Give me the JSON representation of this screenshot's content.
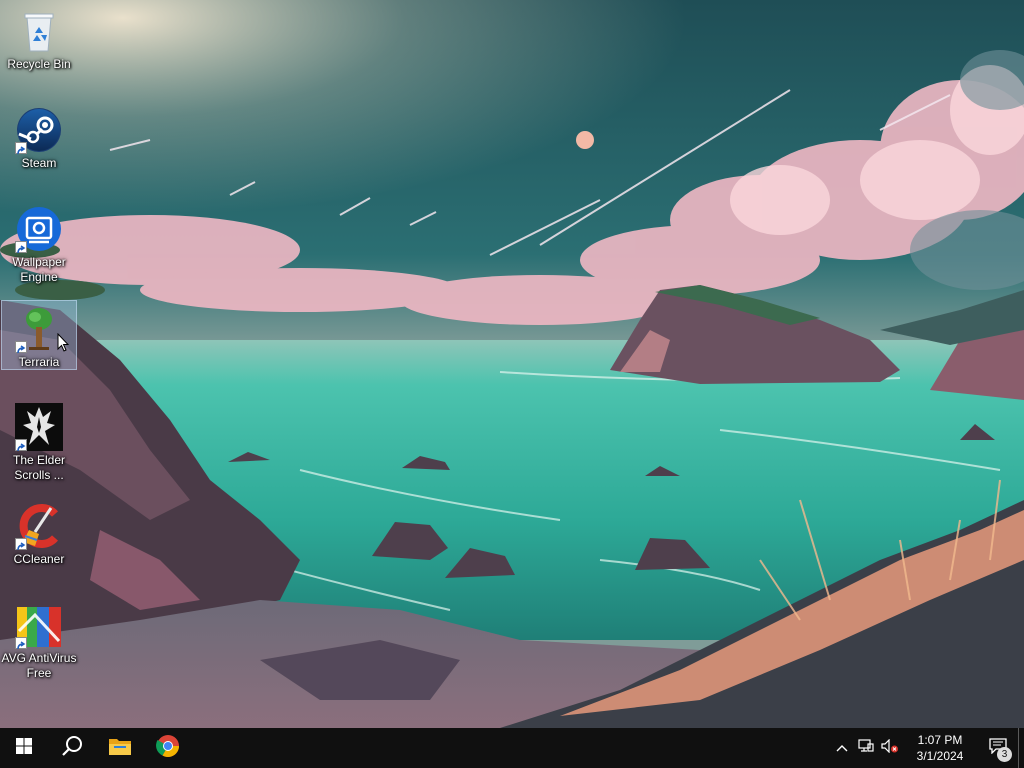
{
  "desktop": {
    "icons": [
      {
        "label": "Recycle Bin",
        "icon": "recycle-bin-icon",
        "shortcut": false,
        "selected": false
      },
      {
        "label": "Steam",
        "icon": "steam-icon",
        "shortcut": true,
        "selected": false
      },
      {
        "label": "Wallpaper Engine",
        "icon": "wallpaper-engine-icon",
        "shortcut": true,
        "selected": false
      },
      {
        "label": "Terraria",
        "icon": "terraria-tree-icon",
        "shortcut": true,
        "selected": true
      },
      {
        "label": "The Elder Scrolls ...",
        "icon": "skyrim-dragon-icon",
        "shortcut": true,
        "selected": false
      },
      {
        "label": "CCleaner",
        "icon": "ccleaner-icon",
        "shortcut": true,
        "selected": false
      },
      {
        "label": "AVG AntiVirus Free",
        "icon": "avg-antivirus-icon",
        "shortcut": true,
        "selected": false
      }
    ]
  },
  "taskbar": {
    "start_icon": "windows-logo-icon",
    "search_icon": "search-icon",
    "pinned": [
      {
        "name": "File Explorer",
        "icon": "file-explorer-icon"
      },
      {
        "name": "Google Chrome",
        "icon": "chrome-icon"
      }
    ],
    "tray": {
      "icons": [
        "chevron-up-icon",
        "network-icon",
        "volume-muted-icon"
      ],
      "time": "1:07 PM",
      "date": "3/1/2024",
      "notification_count": "3"
    }
  },
  "colors": {
    "taskbar_bg": "#101010",
    "selection": "#a5c8eb",
    "sea": "#3bbfa8",
    "sky": "#2a6d72"
  }
}
